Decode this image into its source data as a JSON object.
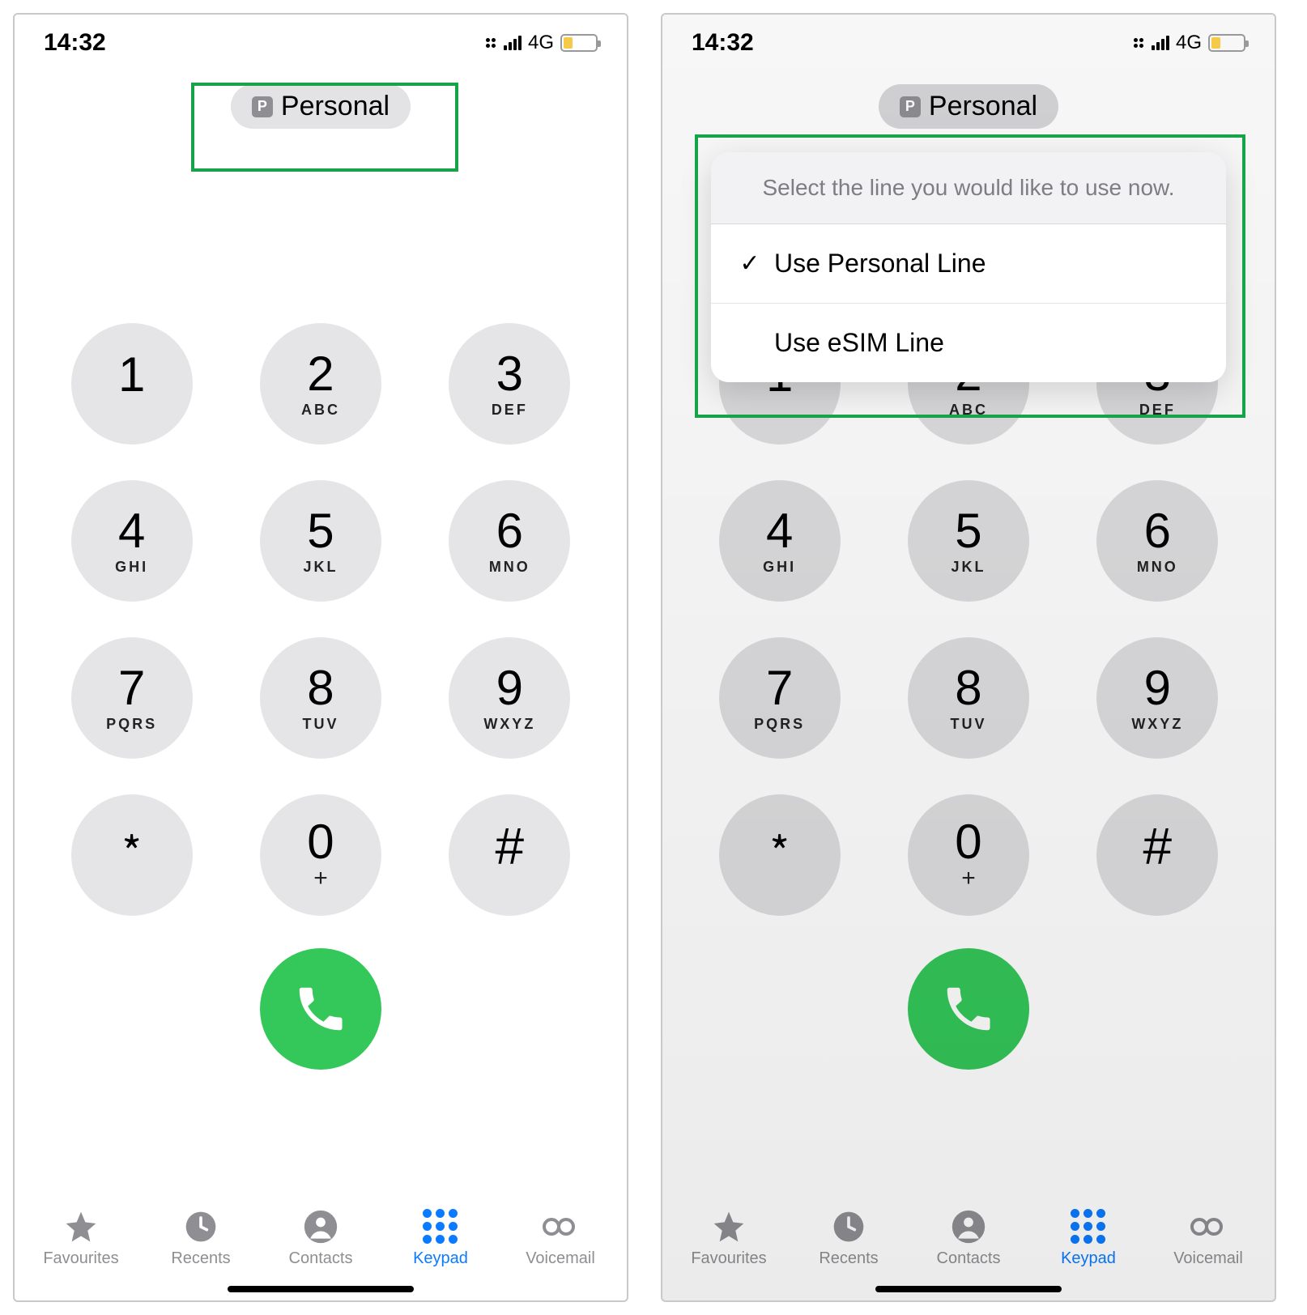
{
  "status": {
    "time": "14:32",
    "network": "4G"
  },
  "line_selector": {
    "badge": "P",
    "label": "Personal"
  },
  "sheet": {
    "title": "Select the line you would like to use now.",
    "options": [
      {
        "checked": true,
        "label": "Use Personal Line"
      },
      {
        "checked": false,
        "label": "Use eSIM Line"
      }
    ]
  },
  "keys": [
    {
      "d": "1",
      "l": ""
    },
    {
      "d": "2",
      "l": "ABC"
    },
    {
      "d": "3",
      "l": "DEF"
    },
    {
      "d": "4",
      "l": "GHI"
    },
    {
      "d": "5",
      "l": "JKL"
    },
    {
      "d": "6",
      "l": "MNO"
    },
    {
      "d": "7",
      "l": "PQRS"
    },
    {
      "d": "8",
      "l": "TUV"
    },
    {
      "d": "9",
      "l": "WXYZ"
    },
    {
      "d": "﹡",
      "l": ""
    },
    {
      "d": "0",
      "l": "+"
    },
    {
      "d": "#",
      "l": ""
    }
  ],
  "tabs": {
    "favourites": "Favourites",
    "recents": "Recents",
    "contacts": "Contacts",
    "keypad": "Keypad",
    "voicemail": "Voicemail"
  },
  "checkmark": "✓"
}
